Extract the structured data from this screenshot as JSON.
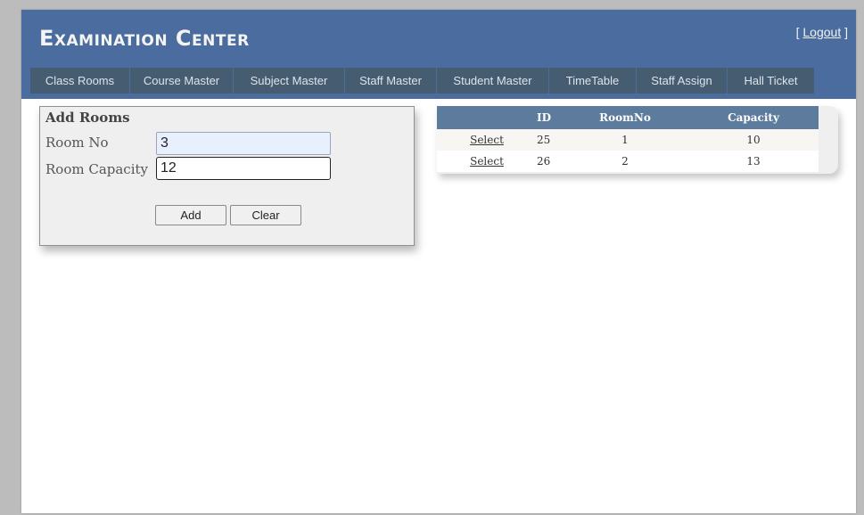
{
  "header": {
    "title": "Examination Center",
    "logout_label": "Logout"
  },
  "menu": {
    "items": [
      {
        "label": "Class Rooms"
      },
      {
        "label": "Course Master"
      },
      {
        "label": "Subject Master"
      },
      {
        "label": "Staff Master"
      },
      {
        "label": "Student Master"
      },
      {
        "label": "TimeTable"
      },
      {
        "label": "Staff Assign"
      },
      {
        "label": "Hall Ticket"
      }
    ]
  },
  "form": {
    "title": "Add Rooms",
    "room_no_label": "Room No",
    "room_no_value": "3",
    "capacity_label": "Room Capacity",
    "capacity_value": "12",
    "add_label": "Add",
    "clear_label": "Clear"
  },
  "grid": {
    "columns": [
      "",
      "ID",
      "RoomNo",
      "Capacity"
    ],
    "rows": [
      {
        "action": "Select",
        "id": "25",
        "room_no": "1",
        "capacity": "10"
      },
      {
        "action": "Select",
        "id": "26",
        "room_no": "2",
        "capacity": "13"
      }
    ]
  },
  "colors": {
    "header_bg": "#4b6c9e",
    "menu_bg": "#465c71",
    "grid_header_bg": "#5d7b9d",
    "row_alt_bg": "#f7f6f3"
  }
}
